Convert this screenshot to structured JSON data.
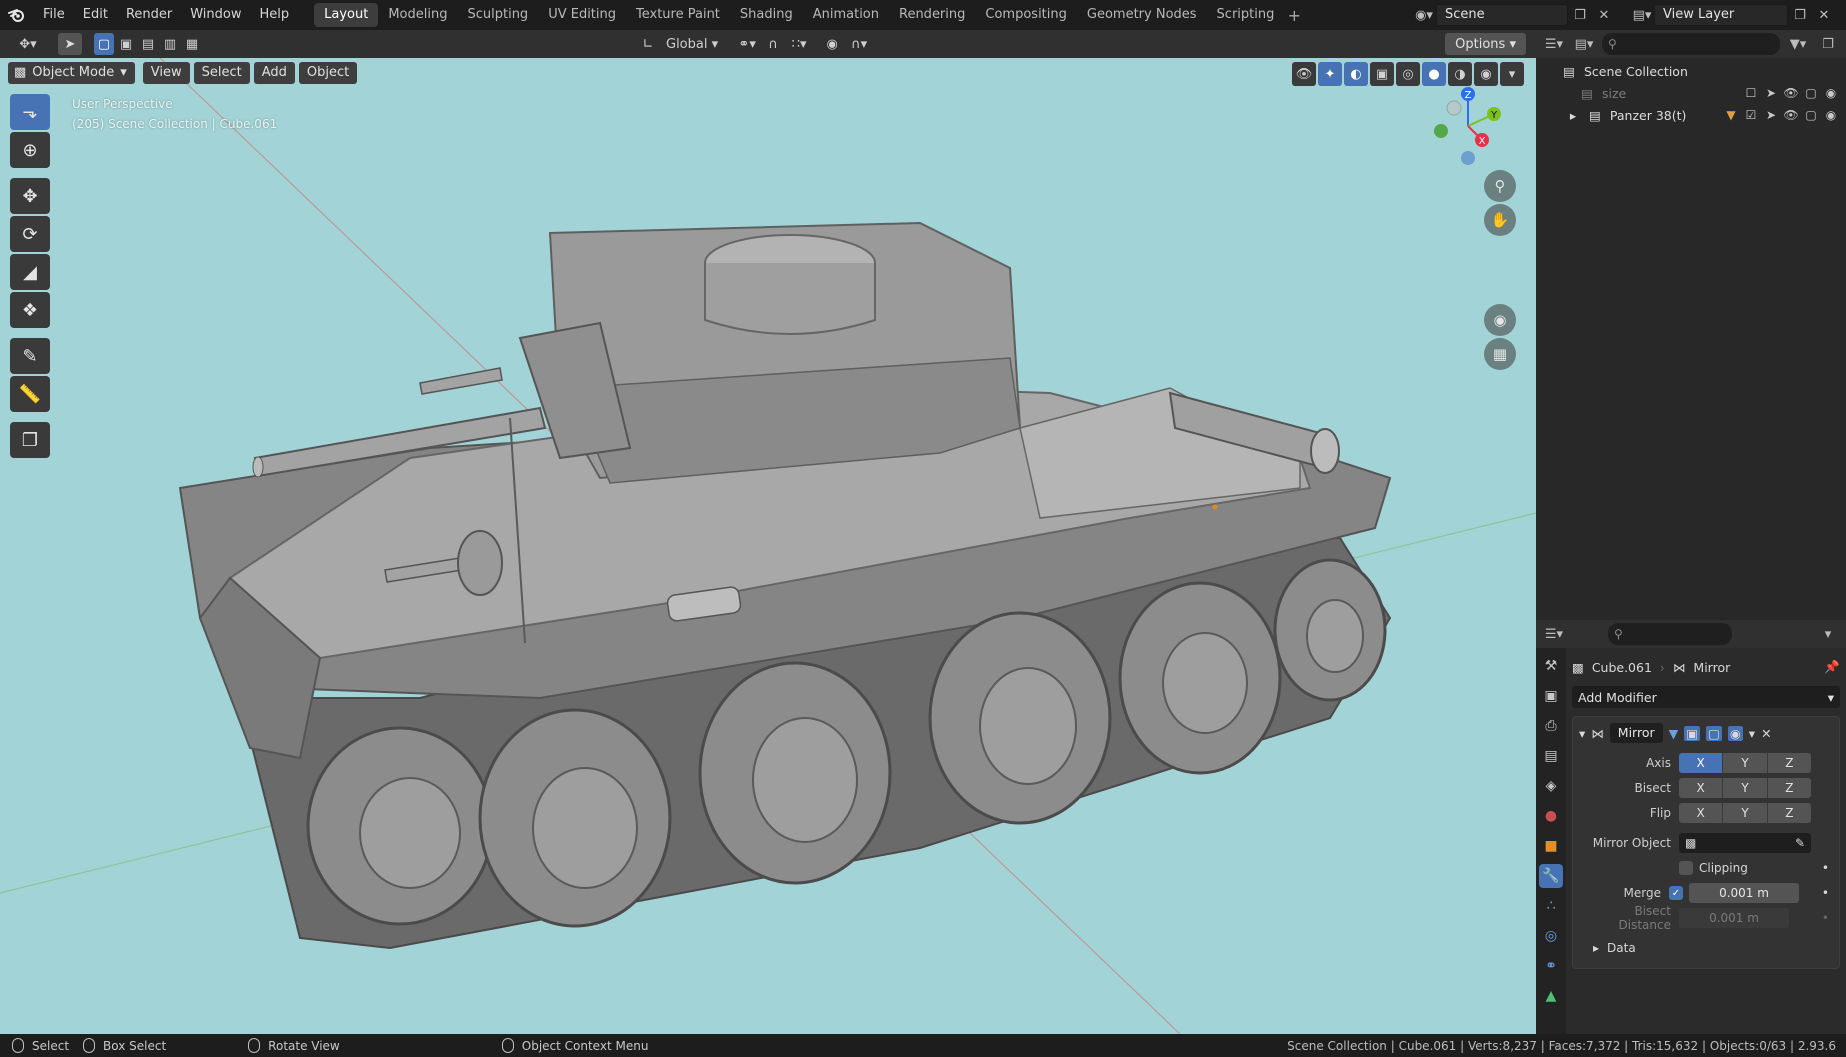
{
  "menu": [
    "File",
    "Edit",
    "Render",
    "Window",
    "Help"
  ],
  "workspaces": [
    {
      "label": "Layout",
      "active": true
    },
    {
      "label": "Modeling"
    },
    {
      "label": "Sculpting"
    },
    {
      "label": "UV Editing"
    },
    {
      "label": "Texture Paint"
    },
    {
      "label": "Shading"
    },
    {
      "label": "Animation"
    },
    {
      "label": "Rendering"
    },
    {
      "label": "Compositing"
    },
    {
      "label": "Geometry Nodes"
    },
    {
      "label": "Scripting"
    }
  ],
  "scene_name": "Scene",
  "view_layer_name": "View Layer",
  "tool_header": {
    "transform_orientation": "Global",
    "options_label": "Options"
  },
  "viewport": {
    "mode": "Object Mode",
    "menus": [
      "View",
      "Select",
      "Add",
      "Object"
    ],
    "info_line1": "User Perspective",
    "info_line2": "(205) Scene Collection | Cube.061",
    "background_color": "#a2d3d6",
    "gizmo_axes": [
      "Z",
      "Y",
      "X"
    ]
  },
  "outliner": {
    "root": "Scene Collection",
    "items": [
      {
        "label": "size",
        "dimmed": true
      },
      {
        "label": "Panzer 38(t)",
        "dimmed": false
      }
    ]
  },
  "properties": {
    "object_name": "Cube.061",
    "modifier_crumb": "Mirror",
    "add_modifier_label": "Add Modifier",
    "modifier": {
      "name": "Mirror",
      "axis_label": "Axis",
      "bisect_label": "Bisect",
      "flip_label": "Flip",
      "axis_options": [
        "X",
        "Y",
        "Z"
      ],
      "axis_selected": "X",
      "mirror_object_label": "Mirror Object",
      "clipping_label": "Clipping",
      "merge_label": "Merge",
      "merge_enabled": true,
      "merge_value": "0.001 m",
      "bisect_distance_label": "Bisect Distance",
      "bisect_distance_value": "0.001 m",
      "data_label": "Data"
    }
  },
  "statusbar": {
    "select": "Select",
    "box_select": "Box Select",
    "rotate_view": "Rotate View",
    "context_menu": "Object Context Menu",
    "stats": "Scene Collection | Cube.061 | Verts:8,237 | Faces:7,372 | Tris:15,632 | Objects:0/63 | 2.93.6"
  },
  "accent_color": "#4772b3"
}
